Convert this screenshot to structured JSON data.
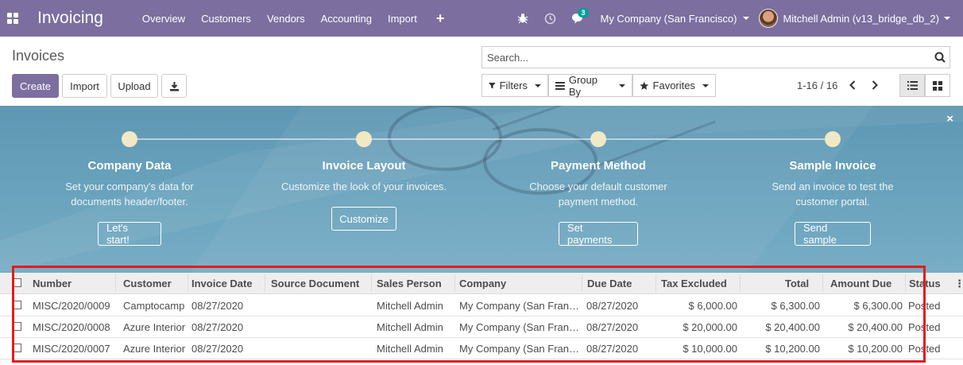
{
  "navbar": {
    "app_title": "Invoicing",
    "menu": [
      "Overview",
      "Customers",
      "Vendors",
      "Accounting",
      "Import"
    ],
    "plus_label": "+",
    "chat_count": "3",
    "company": "My Company (San Francisco)",
    "user": "Mitchell Admin (v13_bridge_db_2)",
    "color": "#7c6f9f"
  },
  "control_panel": {
    "title": "Invoices",
    "buttons": {
      "create": "Create",
      "import": "Import",
      "upload": "Upload"
    },
    "search_placeholder": "Search...",
    "filters": "Filters",
    "group_by": "Group By",
    "favorites": "Favorites",
    "pager": "1-16 / 16"
  },
  "banner": {
    "close": "×",
    "steps": [
      {
        "title": "Company Data",
        "desc1": "Set your company's data for",
        "desc2": "documents header/footer.",
        "button": "Let's start!"
      },
      {
        "title": "Invoice Layout",
        "desc1": "Customize the look of your invoices.",
        "desc2": "",
        "button": "Customize"
      },
      {
        "title": "Payment Method",
        "desc1": "Choose your default customer",
        "desc2": "payment method.",
        "button": "Set payments"
      },
      {
        "title": "Sample Invoice",
        "desc1": "Send an invoice to test the",
        "desc2": "customer portal.",
        "button": "Send sample"
      }
    ]
  },
  "table": {
    "columns": [
      "Number",
      "Customer",
      "Invoice Date",
      "Source Document",
      "Sales Person",
      "Company",
      "Due Date",
      "Tax Excluded",
      "Total",
      "Amount Due",
      "Status"
    ],
    "rows": [
      {
        "number": "MISC/2020/0009",
        "customer": "Camptocamp",
        "invoice_date": "08/27/2020",
        "source": "",
        "sales_person": "Mitchell Admin",
        "company": "My Company (San Fran…",
        "due_date": "08/27/2020",
        "tax_excluded": "$ 6,000.00",
        "total": "$ 6,300.00",
        "amount_due": "$ 6,300.00",
        "status": "Posted"
      },
      {
        "number": "MISC/2020/0008",
        "customer": "Azure Interior",
        "invoice_date": "08/27/2020",
        "source": "",
        "sales_person": "Mitchell Admin",
        "company": "My Company (San Fran…",
        "due_date": "08/27/2020",
        "tax_excluded": "$ 20,000.00",
        "total": "$ 20,400.00",
        "amount_due": "$ 20,400.00",
        "status": "Posted"
      },
      {
        "number": "MISC/2020/0007",
        "customer": "Azure Interior",
        "invoice_date": "08/27/2020",
        "source": "",
        "sales_person": "Mitchell Admin",
        "company": "My Company (San Fran…",
        "due_date": "08/27/2020",
        "tax_excluded": "$ 10,000.00",
        "total": "$ 10,200.00",
        "amount_due": "$ 10,200.00",
        "status": "Posted"
      }
    ]
  },
  "highlight_color": "#e41b1b"
}
